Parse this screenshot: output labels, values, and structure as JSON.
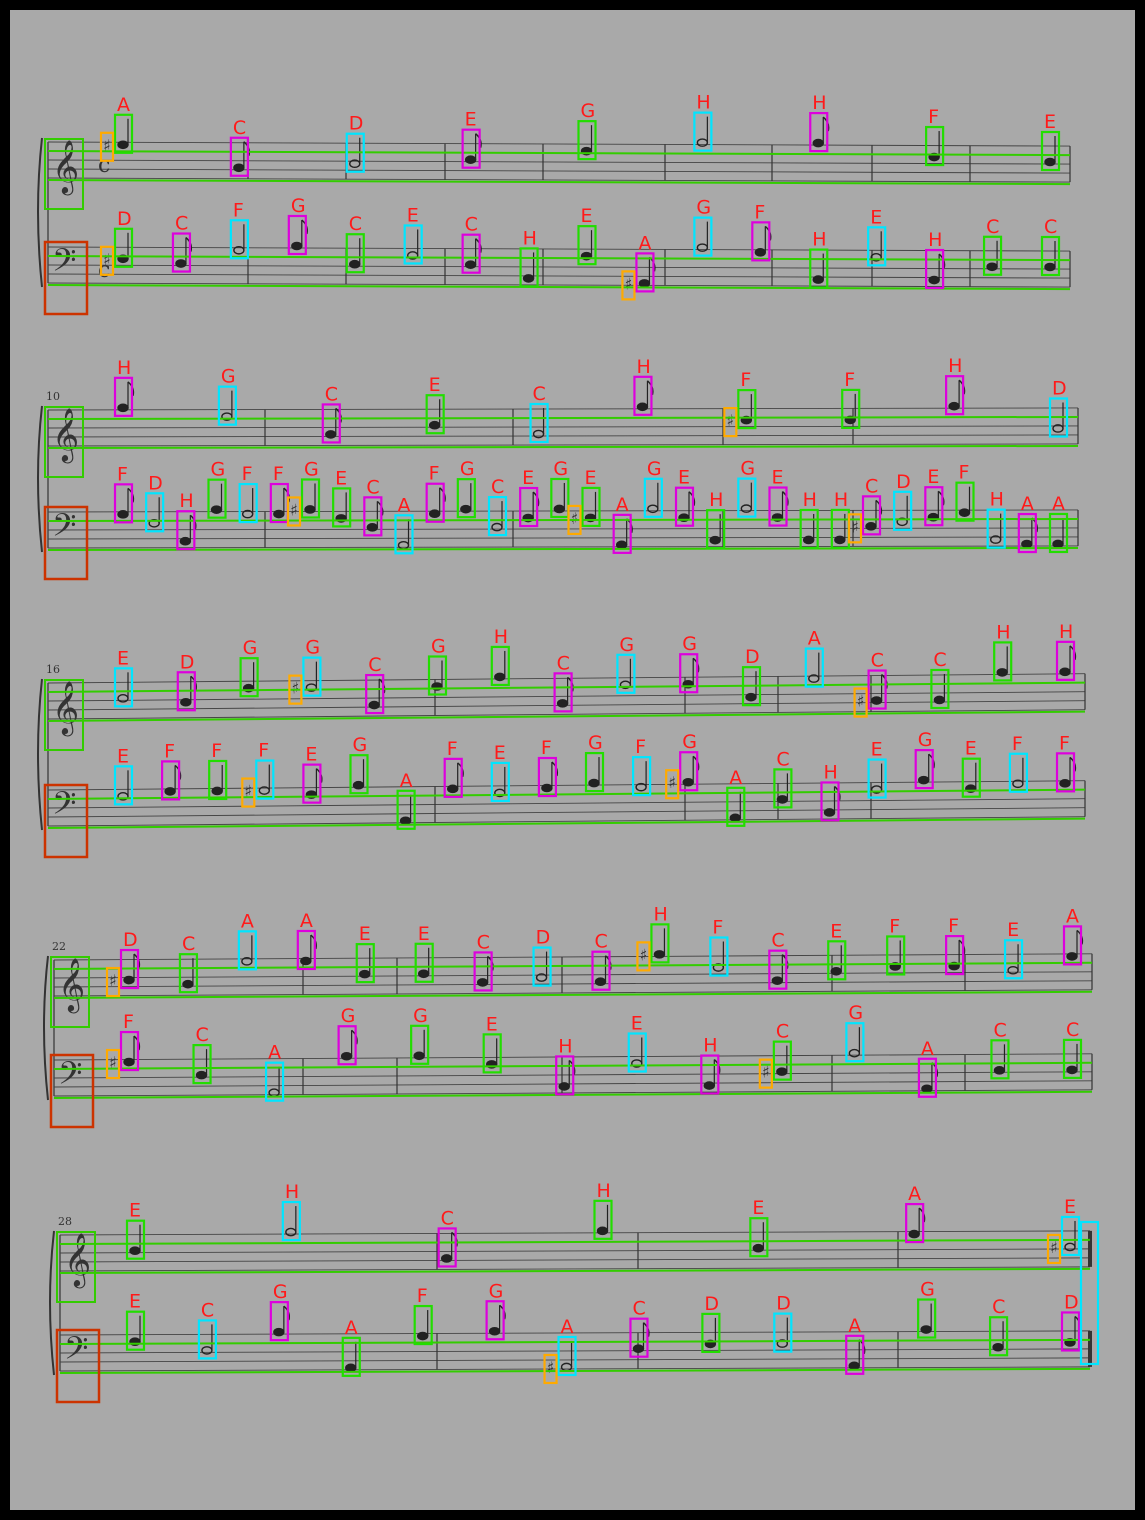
{
  "colors": {
    "paper": "#a9a9a9",
    "staff_box": "#33cc00",
    "clef_box": "#cc3300",
    "note_label": "#ff1a1a",
    "box_whole": "#0000cc",
    "box_half": "#00e5ff",
    "box_quarter": "#22dd00",
    "box_eighth": "#dd00dd",
    "box_accidental": "#ffaa00"
  },
  "systems": [
    {
      "measure_number": "",
      "treble_labels": [
        "A",
        "C",
        "D",
        "E",
        "G",
        "H",
        "H",
        "F",
        "E"
      ],
      "bass_labels": [
        "D",
        "C",
        "F",
        "G",
        "C",
        "E",
        "C",
        "H",
        "E",
        "A",
        "G",
        "F",
        "H",
        "E",
        "H",
        "C",
        "C"
      ]
    },
    {
      "measure_number": "10",
      "treble_labels": [
        "H",
        "G",
        "C",
        "E",
        "C",
        "H",
        "F",
        "F",
        "H",
        "D"
      ],
      "bass_labels": [
        "F",
        "D",
        "H",
        "G",
        "F",
        "F",
        "G",
        "E",
        "C",
        "A",
        "F",
        "G",
        "C",
        "E",
        "G",
        "E",
        "A",
        "G",
        "E",
        "H",
        "G",
        "E",
        "H",
        "H",
        "C",
        "D",
        "E",
        "F",
        "H",
        "A",
        "A"
      ]
    },
    {
      "measure_number": "16",
      "treble_labels": [
        "E",
        "D",
        "G",
        "G",
        "C",
        "G",
        "H",
        "C",
        "G",
        "G",
        "D",
        "A",
        "C",
        "C",
        "H",
        "H"
      ],
      "bass_labels": [
        "E",
        "F",
        "F",
        "F",
        "E",
        "G",
        "A",
        "F",
        "E",
        "F",
        "G",
        "F",
        "G",
        "A",
        "C",
        "H",
        "E",
        "G",
        "E",
        "F",
        "F"
      ]
    },
    {
      "measure_number": "22",
      "treble_labels": [
        "D",
        "C",
        "A",
        "A",
        "E",
        "E",
        "C",
        "D",
        "C",
        "H",
        "F",
        "C",
        "E",
        "F",
        "F",
        "E",
        "A"
      ],
      "bass_labels": [
        "F",
        "C",
        "A",
        "G",
        "G",
        "E",
        "H",
        "E",
        "H",
        "C",
        "G",
        "A",
        "C",
        "C"
      ]
    },
    {
      "measure_number": "28",
      "treble_labels": [
        "E",
        "H",
        "C",
        "H",
        "E",
        "A",
        "E"
      ],
      "bass_labels": [
        "E",
        "C",
        "G",
        "A",
        "F",
        "G",
        "A",
        "C",
        "D",
        "D",
        "A",
        "G",
        "C",
        "D"
      ]
    }
  ]
}
